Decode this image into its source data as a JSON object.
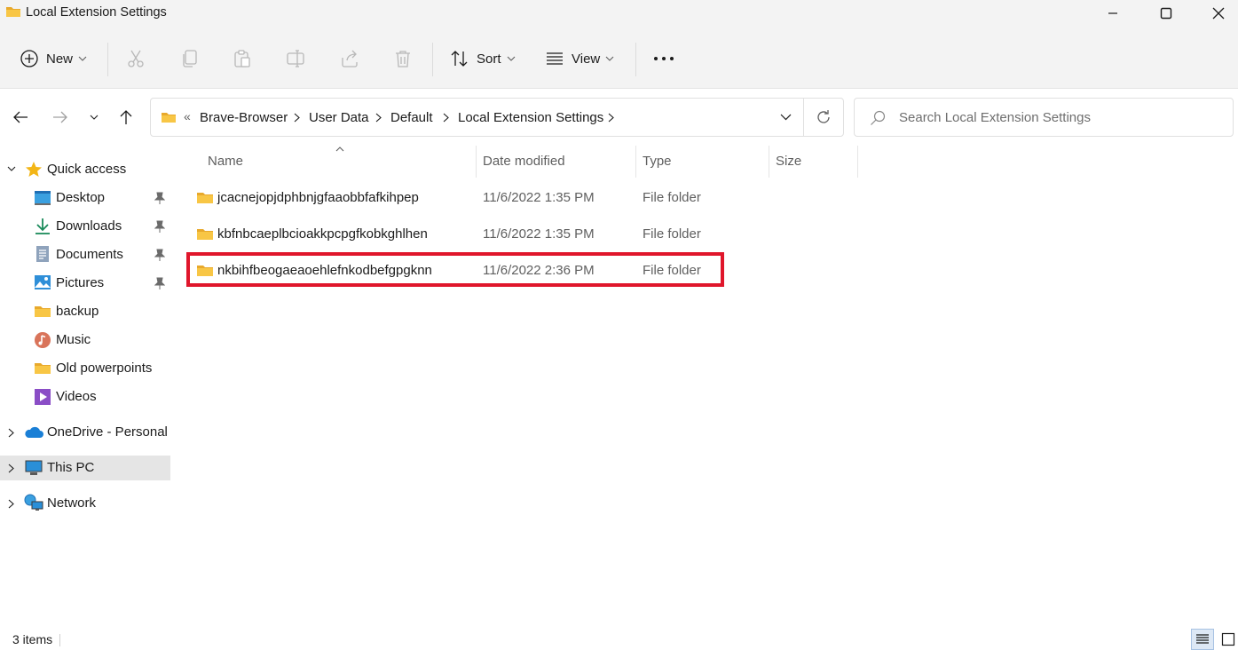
{
  "window": {
    "title": "Local Extension Settings",
    "minimize_icon": "minimize-icon",
    "maximize_icon": "maximize-icon",
    "close_icon": "close-icon"
  },
  "toolbar": {
    "new_label": "New",
    "sort_label": "Sort",
    "view_label": "View",
    "icons": [
      "plus-circle-icon",
      "cut-icon",
      "copy-icon",
      "paste-icon",
      "rename-icon",
      "share-icon",
      "delete-icon",
      "sort-icon",
      "view-icon",
      "more-icon"
    ]
  },
  "address": {
    "breadcrumbs": [
      "Brave-Browser",
      "User Data",
      "Default",
      "Local Extension Settings"
    ],
    "overflow": "«"
  },
  "search": {
    "placeholder": "Search Local Extension Settings"
  },
  "sidebar": {
    "quick_access": "Quick access",
    "items": [
      {
        "label": "Desktop",
        "icon": "desktop-icon",
        "pinned": true
      },
      {
        "label": "Downloads",
        "icon": "download-icon",
        "pinned": true
      },
      {
        "label": "Documents",
        "icon": "document-icon",
        "pinned": true
      },
      {
        "label": "Pictures",
        "icon": "pictures-icon",
        "pinned": true
      },
      {
        "label": "backup",
        "icon": "folder-icon",
        "pinned": false
      },
      {
        "label": "Music",
        "icon": "music-icon",
        "pinned": false
      },
      {
        "label": "Old powerpoints",
        "icon": "folder-icon",
        "pinned": false
      },
      {
        "label": "Videos",
        "icon": "videos-icon",
        "pinned": false
      }
    ],
    "onedrive": "OneDrive - Personal",
    "this_pc": "This PC",
    "network": "Network"
  },
  "files": {
    "columns": [
      "Name",
      "Date modified",
      "Type",
      "Size"
    ],
    "rows": [
      {
        "name": "jcacnejopjdphbnjgfaaobbfafkihpep",
        "date": "11/6/2022 1:35 PM",
        "type": "File folder"
      },
      {
        "name": "kbfnbcaeplbcioakkpcpgfkobkghlhen",
        "date": "11/6/2022 1:35 PM",
        "type": "File folder"
      },
      {
        "name": "nkbihfbeogaeaoehlefnkodbefgpgknn",
        "date": "11/6/2022 2:36 PM",
        "type": "File folder"
      }
    ],
    "highlighted_row": 2,
    "highlight_color": "#e0162b"
  },
  "status": {
    "count": "3 items"
  },
  "colors": {
    "folder": "#f8c645",
    "chrome": "#f3f3f3",
    "selection": "#e5e5e5"
  }
}
